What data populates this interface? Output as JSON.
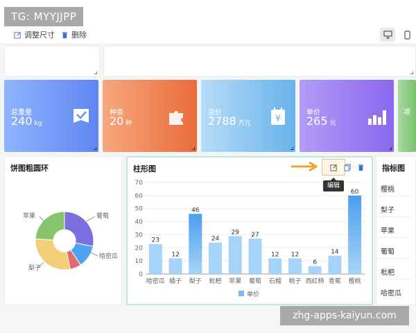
{
  "watermark_top": "TG: MYYJJPP",
  "watermark_bottom": "zhg-apps-kaiyun.com",
  "toolbar": {
    "resize_label": "调整尺寸",
    "delete_label": "删除",
    "view_modes": [
      "desktop",
      "mobile"
    ]
  },
  "cards": [
    {
      "label": "总重量",
      "value": "240",
      "unit": "kg",
      "icon": "check-badge-icon",
      "color_from": "#8fb4ff",
      "color_to": "#5f86f0"
    },
    {
      "label": "种类",
      "value": "20",
      "unit": "种",
      "icon": "puzzle-icon",
      "color_from": "#f7a77f",
      "color_to": "#ea6b3b"
    },
    {
      "label": "总价",
      "value": "2788",
      "unit": "万元",
      "icon": "yen-calendar-icon",
      "color_from": "#b6dcf8",
      "color_to": "#67b3ea"
    },
    {
      "label": "单价",
      "value": "265",
      "unit": "元",
      "icon": "bar-chart-icon",
      "color_from": "#b39cf7",
      "color_to": "#8a67ee"
    },
    {
      "label": "项",
      "value": "",
      "unit": "",
      "icon": "",
      "color_from": "#a8d9a0",
      "color_to": "#7cc36f"
    }
  ],
  "pie_panel": {
    "title": "饼图粗圆环",
    "chart_data": {
      "type": "pie",
      "categories": [
        "葡萄",
        "哈密瓜",
        "",
        "梨子",
        "苹果"
      ],
      "values": [
        27,
        12,
        6,
        28,
        23
      ],
      "colors": [
        "#7b6fe0",
        "#4ea3f1",
        "#e06b74",
        "#f4cf7a",
        "#86c56b"
      ],
      "labels_shown": [
        "苹果",
        "葡萄",
        "哈密瓜",
        "梨子"
      ]
    }
  },
  "bar_panel": {
    "title": "柱形图",
    "edit_tooltip": "编辑",
    "chart_data": {
      "type": "bar",
      "categories": [
        "哈密瓜",
        "橘子",
        "梨子",
        "枇杷",
        "苹果",
        "葡萄",
        "石榴",
        "桃子",
        "西红柿",
        "香蕉",
        "樱桃"
      ],
      "series": [
        {
          "name": "单价",
          "values": [
            23,
            12,
            46,
            24,
            29,
            27,
            12,
            12,
            6,
            14,
            60
          ]
        }
      ],
      "ylim": [
        0,
        70
      ],
      "yticks": [
        0,
        10,
        20,
        30,
        40,
        50,
        60,
        70
      ],
      "title": "",
      "xlabel": "",
      "ylabel": "",
      "legend": "bottom",
      "colors": [
        "#a6d3f7",
        "#4aa0ee"
      ]
    }
  },
  "indicator_panel": {
    "title": "指标图",
    "items": [
      "樱桃",
      "梨子",
      "苹果",
      "葡萄",
      "枇杷",
      "哈密瓜"
    ]
  }
}
